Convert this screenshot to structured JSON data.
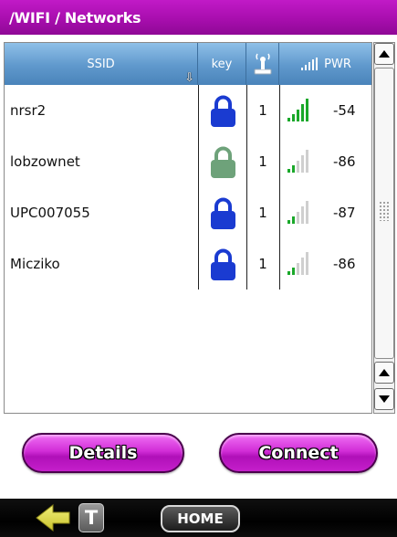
{
  "title": "/WIFI / Networks",
  "table": {
    "headers": {
      "ssid": "SSID",
      "key": "key",
      "pwr": "PWR"
    },
    "sort_indicator": "down-arrow-icon",
    "rows": [
      {
        "ssid": "nrsr2",
        "locked": true,
        "lock_color": "#1a3bd1",
        "channel": "1",
        "signal_bars": 5,
        "pwr": "-54"
      },
      {
        "ssid": "lobzownet",
        "locked": true,
        "lock_color": "#6ea27a",
        "channel": "1",
        "signal_bars": 2,
        "pwr": "-86"
      },
      {
        "ssid": "UPC007055",
        "locked": true,
        "lock_color": "#1a3bd1",
        "channel": "1",
        "signal_bars": 2,
        "pwr": "-87"
      },
      {
        "ssid": "Micziko",
        "locked": true,
        "lock_color": "#1a3bd1",
        "channel": "1",
        "signal_bars": 2,
        "pwr": "-86"
      }
    ]
  },
  "buttons": {
    "details": "Details",
    "connect": "Connect"
  },
  "bottom_bar": {
    "t_label": "T",
    "home_label": "HOME"
  },
  "colors": {
    "accent": "#b310b9",
    "header_blue": "#5f98cc",
    "signal_on": "#1aa82a",
    "signal_off": "#cfcfcf"
  }
}
